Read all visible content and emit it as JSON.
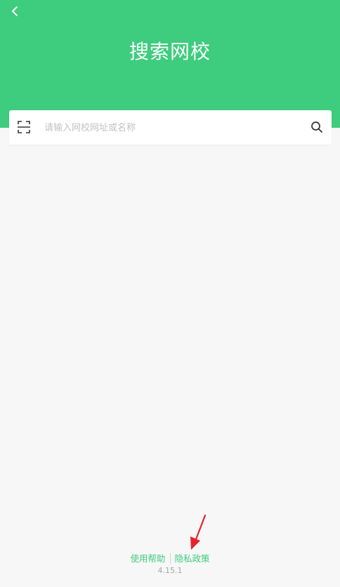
{
  "header": {
    "title": "搜索网校",
    "background_color": "#3ecc7e",
    "back_icon": "chevron-left-icon"
  },
  "search": {
    "placeholder": "请输入网校网址或名称",
    "value": "",
    "scan_icon": "scan-icon",
    "search_icon": "search-icon"
  },
  "footer": {
    "help_label": "使用帮助",
    "privacy_label": "隐私政策",
    "version": "4.15.1",
    "link_color": "#3ecc7e"
  },
  "annotation": {
    "arrow_color": "#e8232c",
    "icon": "red-arrow-pointer"
  }
}
